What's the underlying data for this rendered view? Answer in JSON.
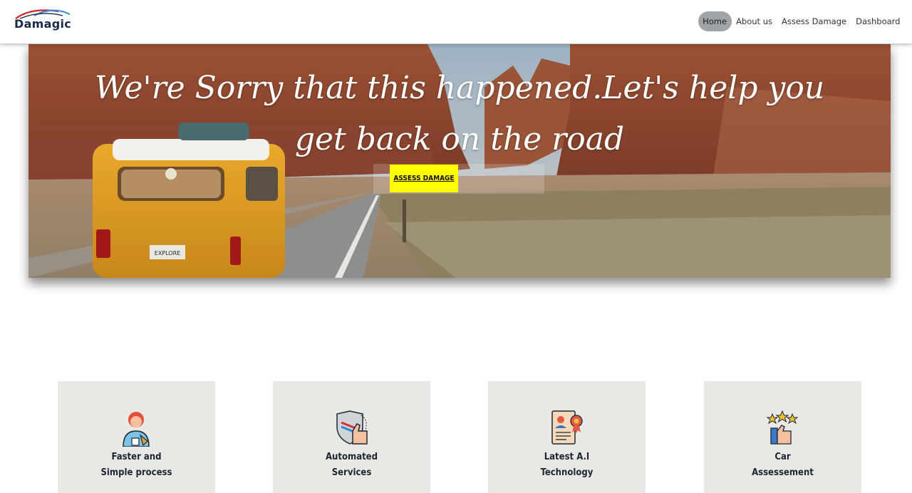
{
  "brand": {
    "name": "Damagic"
  },
  "nav": {
    "items": [
      {
        "label": "Home",
        "active": true
      },
      {
        "label": "About us",
        "active": false
      },
      {
        "label": "Assess Damage",
        "active": false
      },
      {
        "label": "Dashboard",
        "active": false
      }
    ]
  },
  "hero": {
    "title": "We're Sorry that this happened.Let's help you get back on the road",
    "button_label": "ASSESS DAMAGE",
    "van_plate": "EXPLORE",
    "accent": "#ffff00"
  },
  "features": [
    {
      "line1": "Faster and",
      "line2": "Simple process",
      "icon": "person-icon"
    },
    {
      "line1": "Automated",
      "line2": "Services",
      "icon": "shield-thumbs-up-icon"
    },
    {
      "line1": "Latest A.I",
      "line2": "Technology",
      "icon": "certificate-icon"
    },
    {
      "line1": "Car",
      "line2": "Assessement",
      "icon": "star-rating-icon"
    }
  ]
}
